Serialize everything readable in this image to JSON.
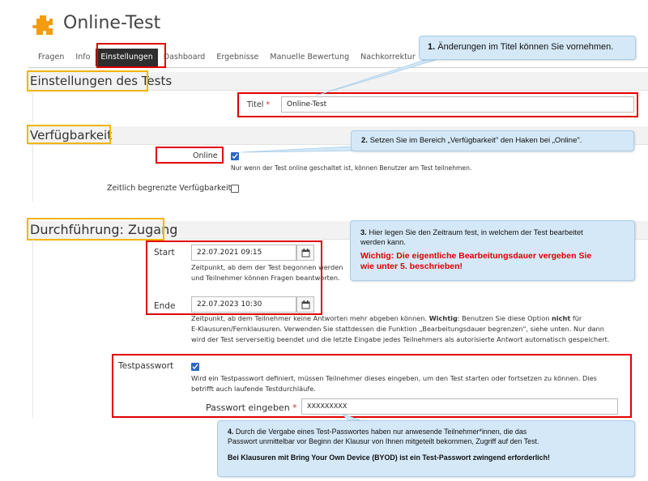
{
  "app": {
    "title": "Online-Test"
  },
  "tabs": [
    {
      "label": "Fragen"
    },
    {
      "label": "Info"
    },
    {
      "label": "Einstellungen",
      "active": true
    },
    {
      "label": "Dashboard"
    },
    {
      "label": "Ergebnisse"
    },
    {
      "label": "Manuelle Bewertung"
    },
    {
      "label": "Nachkorrektur"
    }
  ],
  "sections": {
    "settings": {
      "header": "Einstellungen des Tests",
      "title_label": "Titel",
      "required_mark": "*",
      "title_value": "Online-Test"
    },
    "availability": {
      "header": "Verfügbarkeit",
      "online_label": "Online",
      "online_checked": true,
      "online_help": "Nur wenn der Test online geschaltet ist, können Benutzer am Test teilnehmen.",
      "limited_label": "Zeitlich begrenzte Verfügbarkeit",
      "limited_checked": false
    },
    "access": {
      "header": "Durchführung: Zugang",
      "start_label": "Start",
      "start_value": "22.07.2021 09:15",
      "start_help_1": "Zeitpunkt, ab dem der Test begonnen werden",
      "start_help_2": "und Teilnehmer können Fragen beantworten.",
      "end_label": "Ende",
      "end_value": "22.07.2023 10:30",
      "end_help_a": "Zeitpunkt, ab dem Teilnehmer keine Antworten mehr abgeben können. ",
      "end_help_bold1": "Wichtig",
      "end_help_b": ": Benutzen Sie diese Option ",
      "end_help_bold2": "nicht",
      "end_help_c": " für",
      "end_help_line2": "E-Klausuren/Fernklausuren. Verwenden Sie stattdessen die Funktion „Bearbeitungsdauer begrenzen\", siehe unten. Nur dann",
      "end_help_line3": "wird der Test serverseitig beendet und die letzte Eingabe jedes Teilnehmers als autorisierte Antwort automatisch gespeichert.",
      "password_label": "Testpasswort",
      "password_checked": true,
      "password_help_1": "Wird ein Testpasswort definiert, müssen Teilnehmer dieses eingeben, um den Test starten oder fortsetzen zu können. Dies",
      "password_help_2": "betrifft auch laufende Testdurchläufe.",
      "password_input_label": "Passwort eingeben",
      "password_value": "XXXXXXXXX"
    }
  },
  "callouts": {
    "c1": {
      "num": "1.",
      "text": "Änderungen im Titel können Sie vornehmen."
    },
    "c2": {
      "num": "2.",
      "text": "Setzen Sie im Bereich „Verfügbarkeit\" den Haken bei „Online\"."
    },
    "c3": {
      "num": "3.",
      "text_1": "Hier legen Sie den Zeitraum fest, in welchem der Test bearbeitet",
      "text_2": "werden kann.",
      "warn_1": "Wichtig: Die eigentliche Bearbeitungsdauer vergeben Sie",
      "warn_2": "wie unter 5. beschrieben!"
    },
    "c4": {
      "num": "4.",
      "text_1": "Durch die Vergabe eines Test-Passwortes haben nur anwesende Teilnehmer*innen, die das",
      "text_2": "Passwort unmittelbar vor Beginn der Klausur von Ihnen mitgeteilt bekommen, Zugriff auf den Test.",
      "bold": "Bei Klausuren mit Bring Your Own Device (BYOD) ist ein Test-Passwort zwingend erforderlich!"
    }
  },
  "colors": {
    "highlight_red": "#e00000",
    "highlight_orange": "#f4b400",
    "callout_bg": "#d4e8f7",
    "checkbox_blue": "#2d69c5"
  }
}
